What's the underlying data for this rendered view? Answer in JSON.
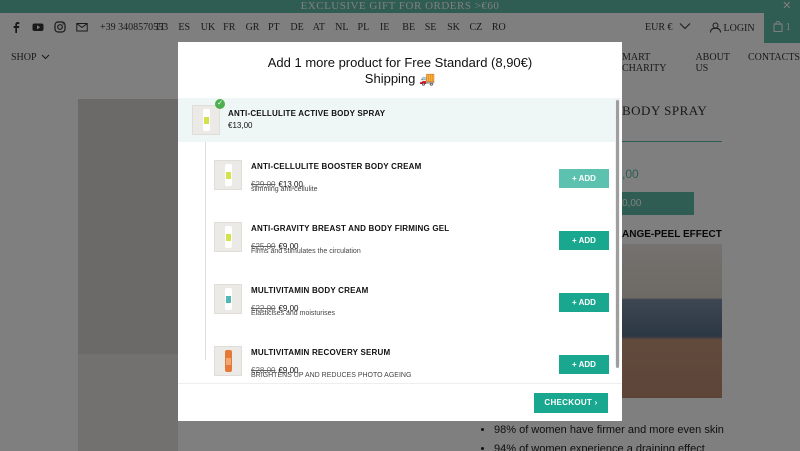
{
  "banner": {
    "text": "EXCLUSIVE GIFT FOR ORDERS >€60",
    "close": "✕"
  },
  "header": {
    "phone": "+39 3408570553",
    "languages": [
      "IT",
      "ES",
      "UK",
      "FR",
      "GR",
      "PT",
      "DE",
      "AT",
      "NL",
      "PL",
      "IE",
      "BE",
      "SE",
      "SK",
      "CZ",
      "RO"
    ],
    "currency": "EUR €",
    "login": "LOGIN",
    "cart_count": "1"
  },
  "nav": {
    "shop": "SHOP",
    "right_items": [
      "MART CHARITY",
      "ABOUT US",
      "CONTACTS"
    ]
  },
  "background_page": {
    "title": "BODY SPRAY",
    "price": ",00",
    "button": "0,00",
    "effect": "ANGE-PEEL EFFECT",
    "bullets": [
      "98% of women have firmer and more even skin",
      "94% of women experience a draining effect"
    ]
  },
  "modal": {
    "title_line1": "Add 1 more product for Free Standard (8,90€)",
    "title_line2": "Shipping 🚚",
    "main_item": {
      "name": "ANTI-CELLULITE ACTIVE BODY SPRAY",
      "price": "€13,00"
    },
    "upsells": [
      {
        "name": "ANTI-CELLULITE BOOSTER BODY CREAM",
        "old_price": "€29,00",
        "price": "€13,00",
        "desc": "slimming anti-cellulite",
        "button": "+ ADD"
      },
      {
        "name": "ANTI-GRAVITY BREAST AND BODY FIRMING GEL",
        "old_price": "€25,00",
        "price": "€9,00",
        "desc": "Firms and stimulates the circulation",
        "button": "+ ADD"
      },
      {
        "name": "MULTIVITAMIN BODY CREAM",
        "old_price": "€22,00",
        "price": "€9,00",
        "desc": "Elasticises and moisturises",
        "button": "+ ADD"
      },
      {
        "name": "MULTIVITAMIN RECOVERY SERUM",
        "old_price": "€28,00",
        "price": "€9,00",
        "desc": "BRIGHTENS UP AND REDUCES PHOTO AGEING",
        "button": "+ ADD"
      }
    ],
    "checkout": "CHECKOUT ›"
  },
  "colors": {
    "accent": "#19a88f",
    "banner": "#5fb8a6"
  }
}
